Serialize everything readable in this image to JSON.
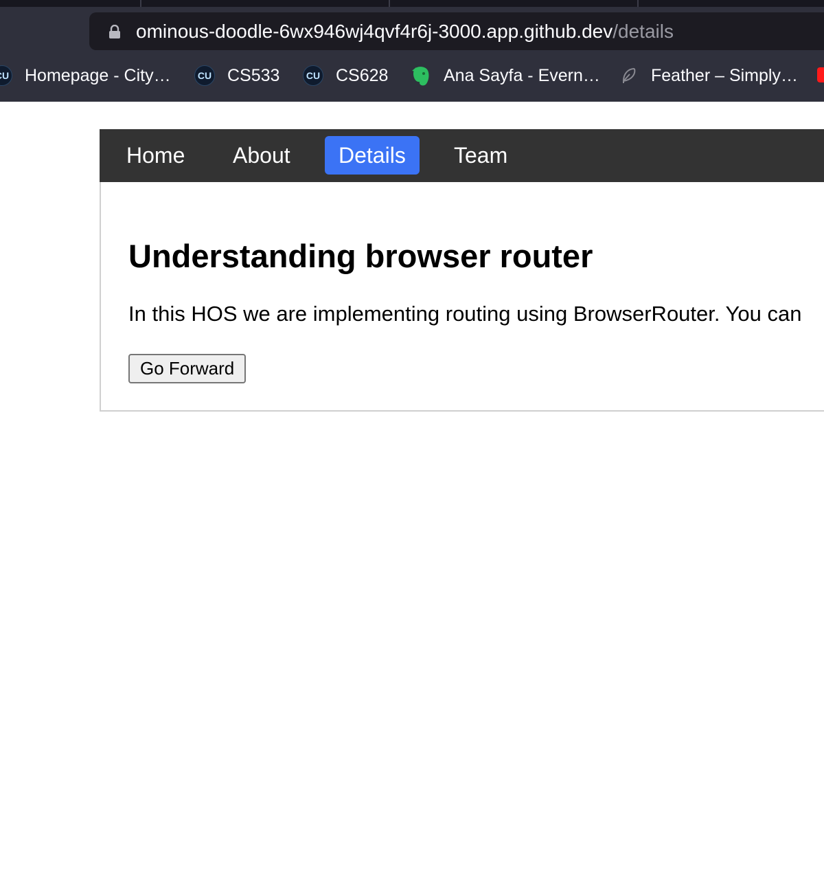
{
  "browser": {
    "url": {
      "host": "ominous-doodle-6wx946wj4qvf4r6j-3000.app.github.dev",
      "path": "/details"
    },
    "bookmarks": [
      {
        "label": "Homepage - City…",
        "icon": "cu-icon"
      },
      {
        "label": "CS533",
        "icon": "cu-icon"
      },
      {
        "label": "CS628",
        "icon": "cu-icon"
      },
      {
        "label": "Ana Sayfa - Evern…",
        "icon": "evernote-icon"
      },
      {
        "label": "Feather – Simply…",
        "icon": "feather-icon"
      }
    ],
    "colors": {
      "chrome_bg": "#2f303c",
      "urlbar_bg": "#1c1b22",
      "evernote_green": "#2dbe60"
    }
  },
  "nav": {
    "items": [
      {
        "label": "Home"
      },
      {
        "label": "About"
      },
      {
        "label": "Details"
      },
      {
        "label": "Team"
      }
    ],
    "active": "Details",
    "active_color": "#3b73f5",
    "bar_color": "#333333"
  },
  "page": {
    "heading": "Understanding browser router",
    "text": "In this HOS we are implementing routing using BrowserRouter. You can",
    "button_label": "Go Forward"
  }
}
